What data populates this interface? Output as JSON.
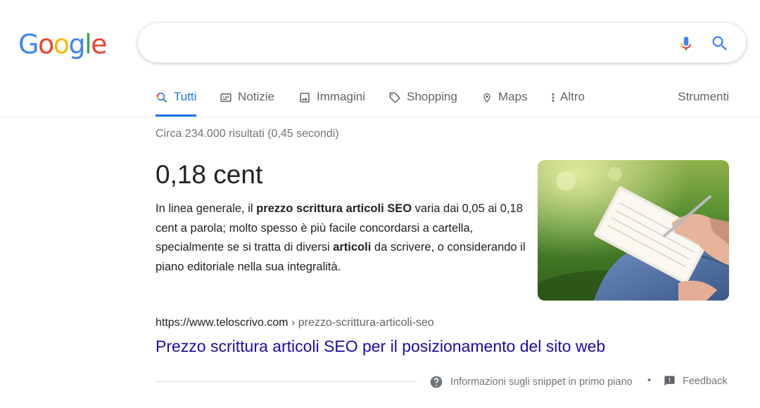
{
  "logo": {
    "letters": [
      "G",
      "o",
      "o",
      "g",
      "l",
      "e"
    ],
    "colors": [
      "#4285F4",
      "#EA4335",
      "#FBBC05",
      "#4285F4",
      "#34A853",
      "#EA4335"
    ]
  },
  "search": {
    "query": "",
    "mic_icon": "mic-icon",
    "search_icon": "search-icon"
  },
  "tabs": [
    {
      "label": "Tutti",
      "icon": "search-icon",
      "active": true
    },
    {
      "label": "Notizie",
      "icon": "news-icon"
    },
    {
      "label": "Immagini",
      "icon": "image-icon"
    },
    {
      "label": "Shopping",
      "icon": "tag-icon"
    },
    {
      "label": "Maps",
      "icon": "map-pin-icon"
    },
    {
      "label": "Altro",
      "icon": "more-vert-icon"
    }
  ],
  "tools_label": "Strumenti",
  "result_stats": "Circa 234.000 risultati (0,45 secondi)",
  "featured_snippet": {
    "answer": "0,18 cent",
    "text_parts": [
      {
        "text": "In linea generale, il ",
        "bold": false
      },
      {
        "text": "prezzo scrittura articoli SEO",
        "bold": true
      },
      {
        "text": " varia dai 0,05 ai 0,18 cent a parola; molto spesso è più facile concordarsi a cartella, specialmente se si tratta di diversi ",
        "bold": false
      },
      {
        "text": "articoli",
        "bold": true
      },
      {
        "text": " da scrivere, o considerando il piano editoriale nella sua integralità.",
        "bold": false
      }
    ],
    "image_icon": "notebook-writing-photo",
    "url_domain": "https://www.teloscrivo.com",
    "url_path": " › prezzo-scrittura-articoli-seo",
    "title": "Prezzo scrittura articoli SEO per il posizionamento del sito web"
  },
  "footer": {
    "info_label": "Informazioni sugli snippet in primo piano",
    "separator": "•",
    "feedback_label": "Feedback",
    "info_icon": "help-icon",
    "feedback_icon": "feedback-icon"
  },
  "colors": {
    "link": "#1a0dab",
    "accent": "#1a73e8",
    "muted": "#70757a"
  }
}
